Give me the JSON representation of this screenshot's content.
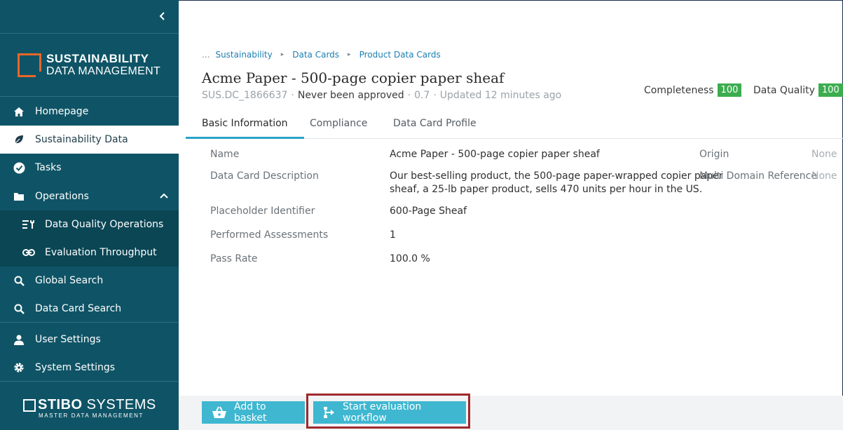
{
  "sidebar": {
    "logo": {
      "line1": "SUSTAINABILITY",
      "line2": "DATA MANAGEMENT",
      "accent": "#e8662a"
    },
    "items": [
      {
        "label": "Homepage",
        "icon": "home-icon"
      },
      {
        "label": "Sustainability Data",
        "icon": "leaf-icon",
        "active": true
      },
      {
        "label": "Tasks",
        "icon": "check-circle-icon"
      },
      {
        "label": "Operations",
        "icon": "folder-icon",
        "expanded": true
      },
      {
        "label": "Data Quality Operations",
        "icon": "list-tools-icon",
        "sub": true
      },
      {
        "label": "Evaluation Throughput",
        "icon": "link-icon",
        "sub": true
      },
      {
        "label": "Global Search",
        "icon": "search-icon"
      },
      {
        "label": "Data Card Search",
        "icon": "search-icon"
      },
      {
        "label": "User Settings",
        "icon": "user-icon"
      },
      {
        "label": "System Settings",
        "icon": "gear-icon"
      }
    ],
    "vendor": {
      "name_bold": "STIBO",
      "name_rest": " SYSTEMS",
      "tagline": "MASTER DATA MANAGEMENT"
    },
    "background": "#0f5466"
  },
  "breadcrumb": {
    "ellipsis": "...",
    "items": [
      "Sustainability",
      "Data Cards",
      "Product Data Cards"
    ],
    "separator": "▸"
  },
  "record": {
    "title": "Acme Paper - 500-page copier paper sheaf",
    "id": "SUS.DC_1866637",
    "separator": "·",
    "approval": "Never been approved",
    "version": "0.7",
    "updated": "Updated 12 minutes ago"
  },
  "metrics": {
    "completeness": {
      "label": "Completeness",
      "value": "100"
    },
    "quality": {
      "label": "Data Quality",
      "value": "100"
    },
    "color": "#3cad4f"
  },
  "tabs": [
    {
      "label": "Basic Information",
      "active": true
    },
    {
      "label": "Compliance"
    },
    {
      "label": "Data Card Profile"
    }
  ],
  "fields": [
    {
      "label": "Name",
      "value": "Acme Paper - 500-page copier paper sheaf"
    },
    {
      "label": "Data Card Description",
      "value_line1": "Our best-selling product, the 500-page paper-wrapped copier paper",
      "value_line2": "sheaf, a 25-lb paper product, sells 470 units per hour in the US."
    },
    {
      "label": "Placeholder Identifier",
      "value": "600-Page Sheaf"
    },
    {
      "label": "Performed Assessments",
      "value": "1"
    },
    {
      "label": "Pass Rate",
      "value": "100.0 %"
    }
  ],
  "side_fields": [
    {
      "label": "Origin",
      "value": "None"
    },
    {
      "label": "Multi Domain Reference",
      "value": "None"
    }
  ],
  "footer": {
    "basket_label": "Add to basket",
    "workflow_label": "Start evaluation workflow",
    "button_color": "#3fb7d0",
    "highlight_color": "#a0282c"
  }
}
